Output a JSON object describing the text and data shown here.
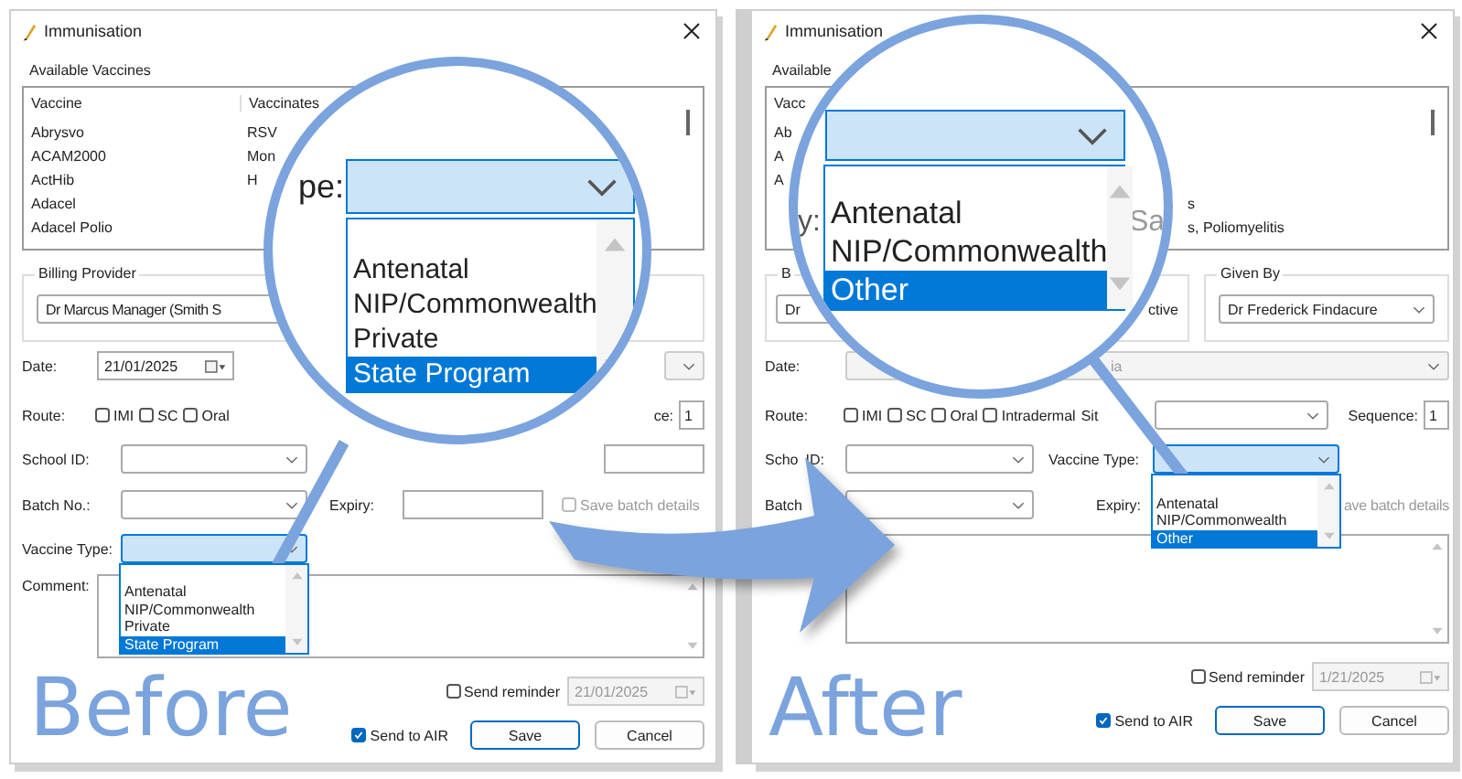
{
  "before": {
    "caption": "Before",
    "window": {
      "title": "Immunisation"
    },
    "vaccines": {
      "label": "Available Vaccines",
      "columns": [
        "Vaccine",
        "Vaccinates"
      ],
      "rows": [
        {
          "vaccine": "Abrysvo",
          "vaccinates": "RSV"
        },
        {
          "vaccine": "ACAM2000",
          "vaccinates": "Mon"
        },
        {
          "vaccine": "ActHib",
          "vaccinates": "H"
        },
        {
          "vaccine": "Adacel"
        },
        {
          "vaccine": "Adacel Polio"
        }
      ]
    },
    "billing_provider": {
      "label": "Billing Provider",
      "value": "Dr Marcus Manager (Smith S"
    },
    "date": {
      "label": "Date:",
      "value": "21/01/2025"
    },
    "route": {
      "label": "Route:",
      "options": [
        {
          "label": "IMI",
          "checked": false
        },
        {
          "label": "SC",
          "checked": false
        },
        {
          "label": "Oral",
          "checked": false
        }
      ]
    },
    "sequence": {
      "label": "ce:",
      "value": "1"
    },
    "school_id": {
      "label": "School ID:"
    },
    "batch_no": {
      "label": "Batch No.:"
    },
    "expiry": {
      "label": "Expiry:"
    },
    "save_batch": {
      "label": "Save batch details",
      "checked": false,
      "disabled": true
    },
    "vaccine_type": {
      "label": "Vaccine Type:",
      "expanded": true,
      "options": [
        {
          "label": "Antenatal",
          "selected": false
        },
        {
          "label": "NIP/Commonwealth",
          "selected": false
        },
        {
          "label": "Private",
          "selected": false
        },
        {
          "label": "State Program",
          "selected": true
        }
      ]
    },
    "comment": {
      "label": "Comment:"
    },
    "send_reminder": {
      "label": "Send reminder",
      "checked": false,
      "date": "21/01/2025",
      "date_disabled": true
    },
    "send_to_air": {
      "label": "Send to AIR",
      "checked": true
    },
    "buttons": [
      "Save",
      "Cancel"
    ],
    "magnifier": {
      "label": "pe:",
      "options": [
        {
          "label": "Antenatal",
          "selected": false
        },
        {
          "label": "NIP/Commonwealth",
          "selected": false
        },
        {
          "label": "Private",
          "selected": false
        },
        {
          "label": "State Program",
          "selected": true
        }
      ]
    }
  },
  "after": {
    "caption": "After",
    "window": {
      "title": "Immunisation"
    },
    "vaccines": {
      "label": "Available",
      "column_1": "Vacc",
      "rows": [
        {
          "vaccine": "Ab"
        },
        {
          "vaccine": "A"
        },
        {
          "vaccine": "A"
        },
        {
          "vaccinates": "s"
        },
        {
          "vaccinates": "s, Poliomyelitis"
        }
      ]
    },
    "billing_provider": {
      "label": "B",
      "value": "Dr",
      "inactive_label": "ctive"
    },
    "given_by": {
      "label": "Given By",
      "value": "Dr Frederick Findacure"
    },
    "date": {
      "label": "Date:",
      "value": "ia"
    },
    "route": {
      "label": "Route:",
      "options": [
        {
          "label": "IMI",
          "checked": false
        },
        {
          "label": "SC",
          "checked": false
        },
        {
          "label": "Oral",
          "checked": false
        },
        {
          "label": "Intradermal",
          "checked": false
        }
      ],
      "site_label": "Sit"
    },
    "sequence": {
      "label": "Sequence:",
      "value": "1"
    },
    "school_id": {
      "label_parts": [
        "Scho",
        "ID:"
      ]
    },
    "vaccine_type": {
      "label": "Vaccine Type:",
      "expanded": true,
      "options": [
        {
          "label": "Antenatal",
          "selected": false
        },
        {
          "label": "NIP/Commonwealth",
          "selected": false
        },
        {
          "label": "Other",
          "selected": true
        }
      ]
    },
    "batch_no": {
      "label": "Batch"
    },
    "expiry": {
      "label": "Expiry:"
    },
    "save_batch": {
      "label": "ave batch details",
      "disabled": true
    },
    "send_reminder": {
      "label": "Send reminder",
      "checked": false,
      "date": "1/21/2025",
      "date_disabled": true
    },
    "send_to_air": {
      "label": "Send to AIR",
      "checked": true
    },
    "buttons": [
      "Save",
      "Cancel"
    ],
    "magnifier": {
      "fragments": [
        "y:",
        "Sa"
      ],
      "options": [
        {
          "label": "Antenatal",
          "selected": false
        },
        {
          "label": "NIP/Commonwealth",
          "selected": false
        },
        {
          "label": "Other",
          "selected": true
        }
      ]
    }
  }
}
